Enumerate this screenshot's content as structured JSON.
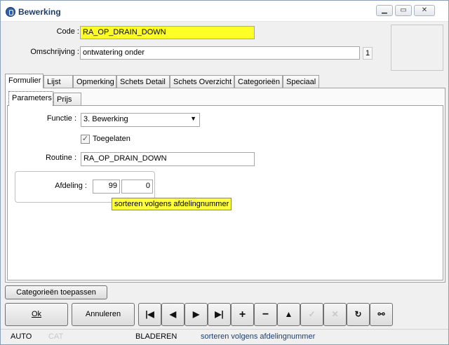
{
  "window": {
    "title": "Bewerking"
  },
  "header": {
    "code_label": "Code :",
    "code_value": "RA_OP_DRAIN_DOWN",
    "desc_label": "Omschrijving :",
    "desc_value": "ontwatering onder",
    "desc_count": "1"
  },
  "tabs": [
    "Formulier",
    "Lijst",
    "Opmerking",
    "Schets Detail",
    "Schets Overzicht",
    "Categorieën",
    "Speciaal"
  ],
  "subtabs": [
    "Parameters",
    "Prijs"
  ],
  "form": {
    "functie_label": "Functie :",
    "functie_value": "3.  Bewerking",
    "toegelaten_label": "Toegelaten",
    "toegelaten_checked": true,
    "routine_label": "Routine :",
    "routine_value": "RA_OP_DRAIN_DOWN",
    "afdeling_label": "Afdeling :",
    "afdeling_value1": "99",
    "afdeling_value2": "0",
    "tooltip": "sorteren volgens afdelingnummer"
  },
  "buttons": {
    "categorieen": "Categorieën toepassen",
    "ok": "Ok",
    "annuleren": "Annuleren"
  },
  "nav_icons": [
    "first-record-icon",
    "previous-record-icon",
    "next-record-icon",
    "last-record-icon",
    "add-record-icon",
    "delete-record-icon",
    "up-icon",
    "confirm-icon",
    "cancel-icon",
    "refresh-icon",
    "binoculars-icon"
  ],
  "status": {
    "mode": "AUTO",
    "cat": "CAT",
    "state": "BLADEREN",
    "message": "sorteren volgens afdelingnummer"
  },
  "colors": {
    "highlight": "#ffff26",
    "title": "#1f3e6b",
    "status_message": "#1f3e6b"
  }
}
